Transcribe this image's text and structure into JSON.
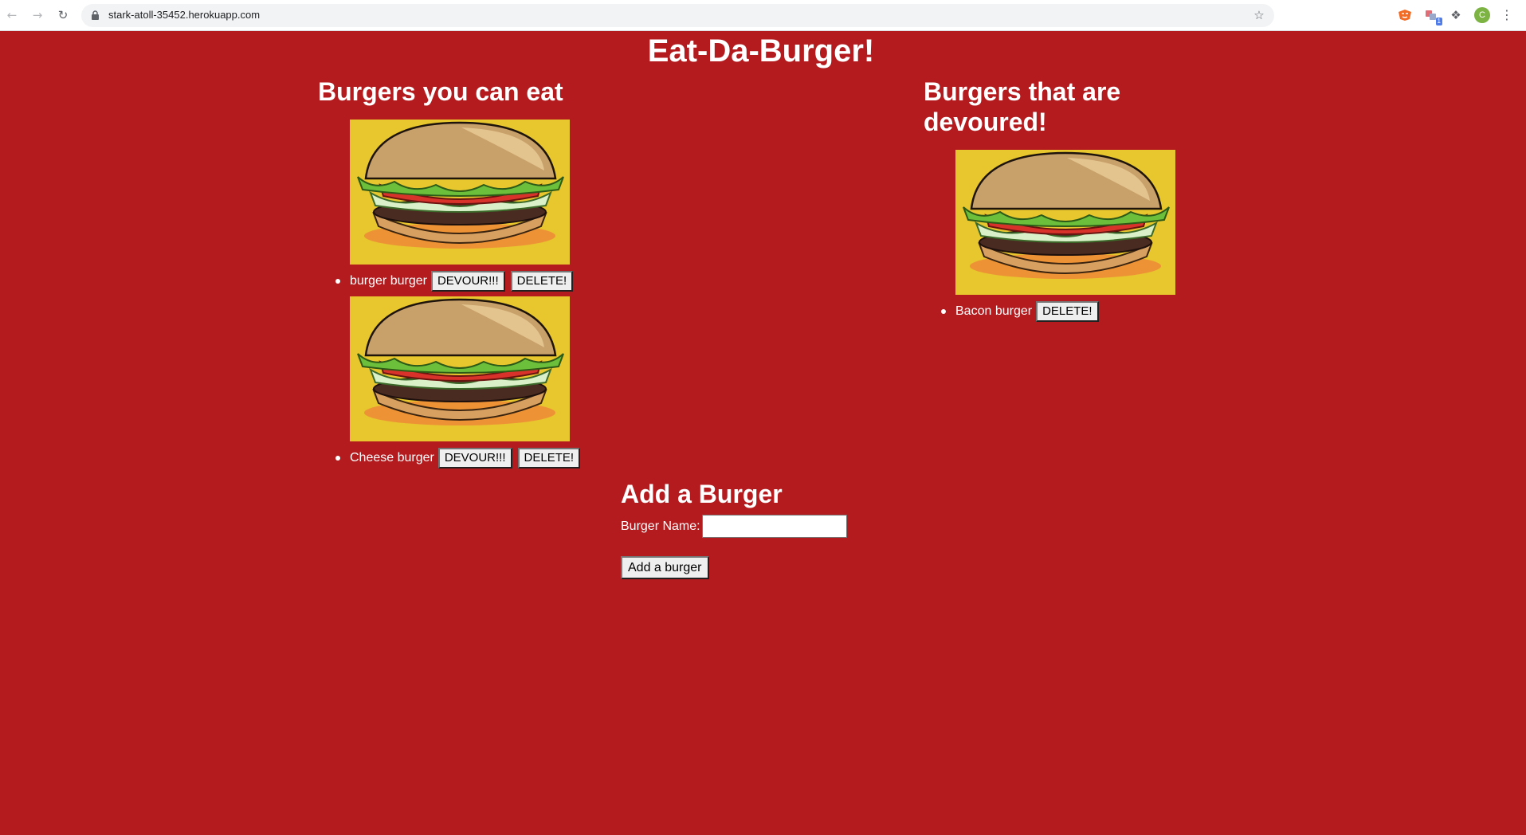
{
  "browser": {
    "url": "stark-atoll-35452.herokuapp.com",
    "extension_badge": "1",
    "profile_initial": "C"
  },
  "page": {
    "title": "Eat-Da-Burger!"
  },
  "uneaten": {
    "heading": "Burgers you can eat",
    "items": [
      {
        "name": "burger burger",
        "devour_label": "DEVOUR!!!",
        "delete_label": "DELETE!"
      },
      {
        "name": "Cheese burger",
        "devour_label": "DEVOUR!!!",
        "delete_label": "DELETE!"
      }
    ]
  },
  "devoured": {
    "heading": "Burgers that are devoured!",
    "items": [
      {
        "name": "Bacon burger",
        "delete_label": "DELETE!"
      }
    ]
  },
  "add_form": {
    "heading": "Add a Burger",
    "label": "Burger Name:",
    "input_value": "",
    "submit_label": "Add a burger"
  },
  "colors": {
    "page_background": "#b31b1f",
    "burger_image_background": "#e8c62e"
  }
}
